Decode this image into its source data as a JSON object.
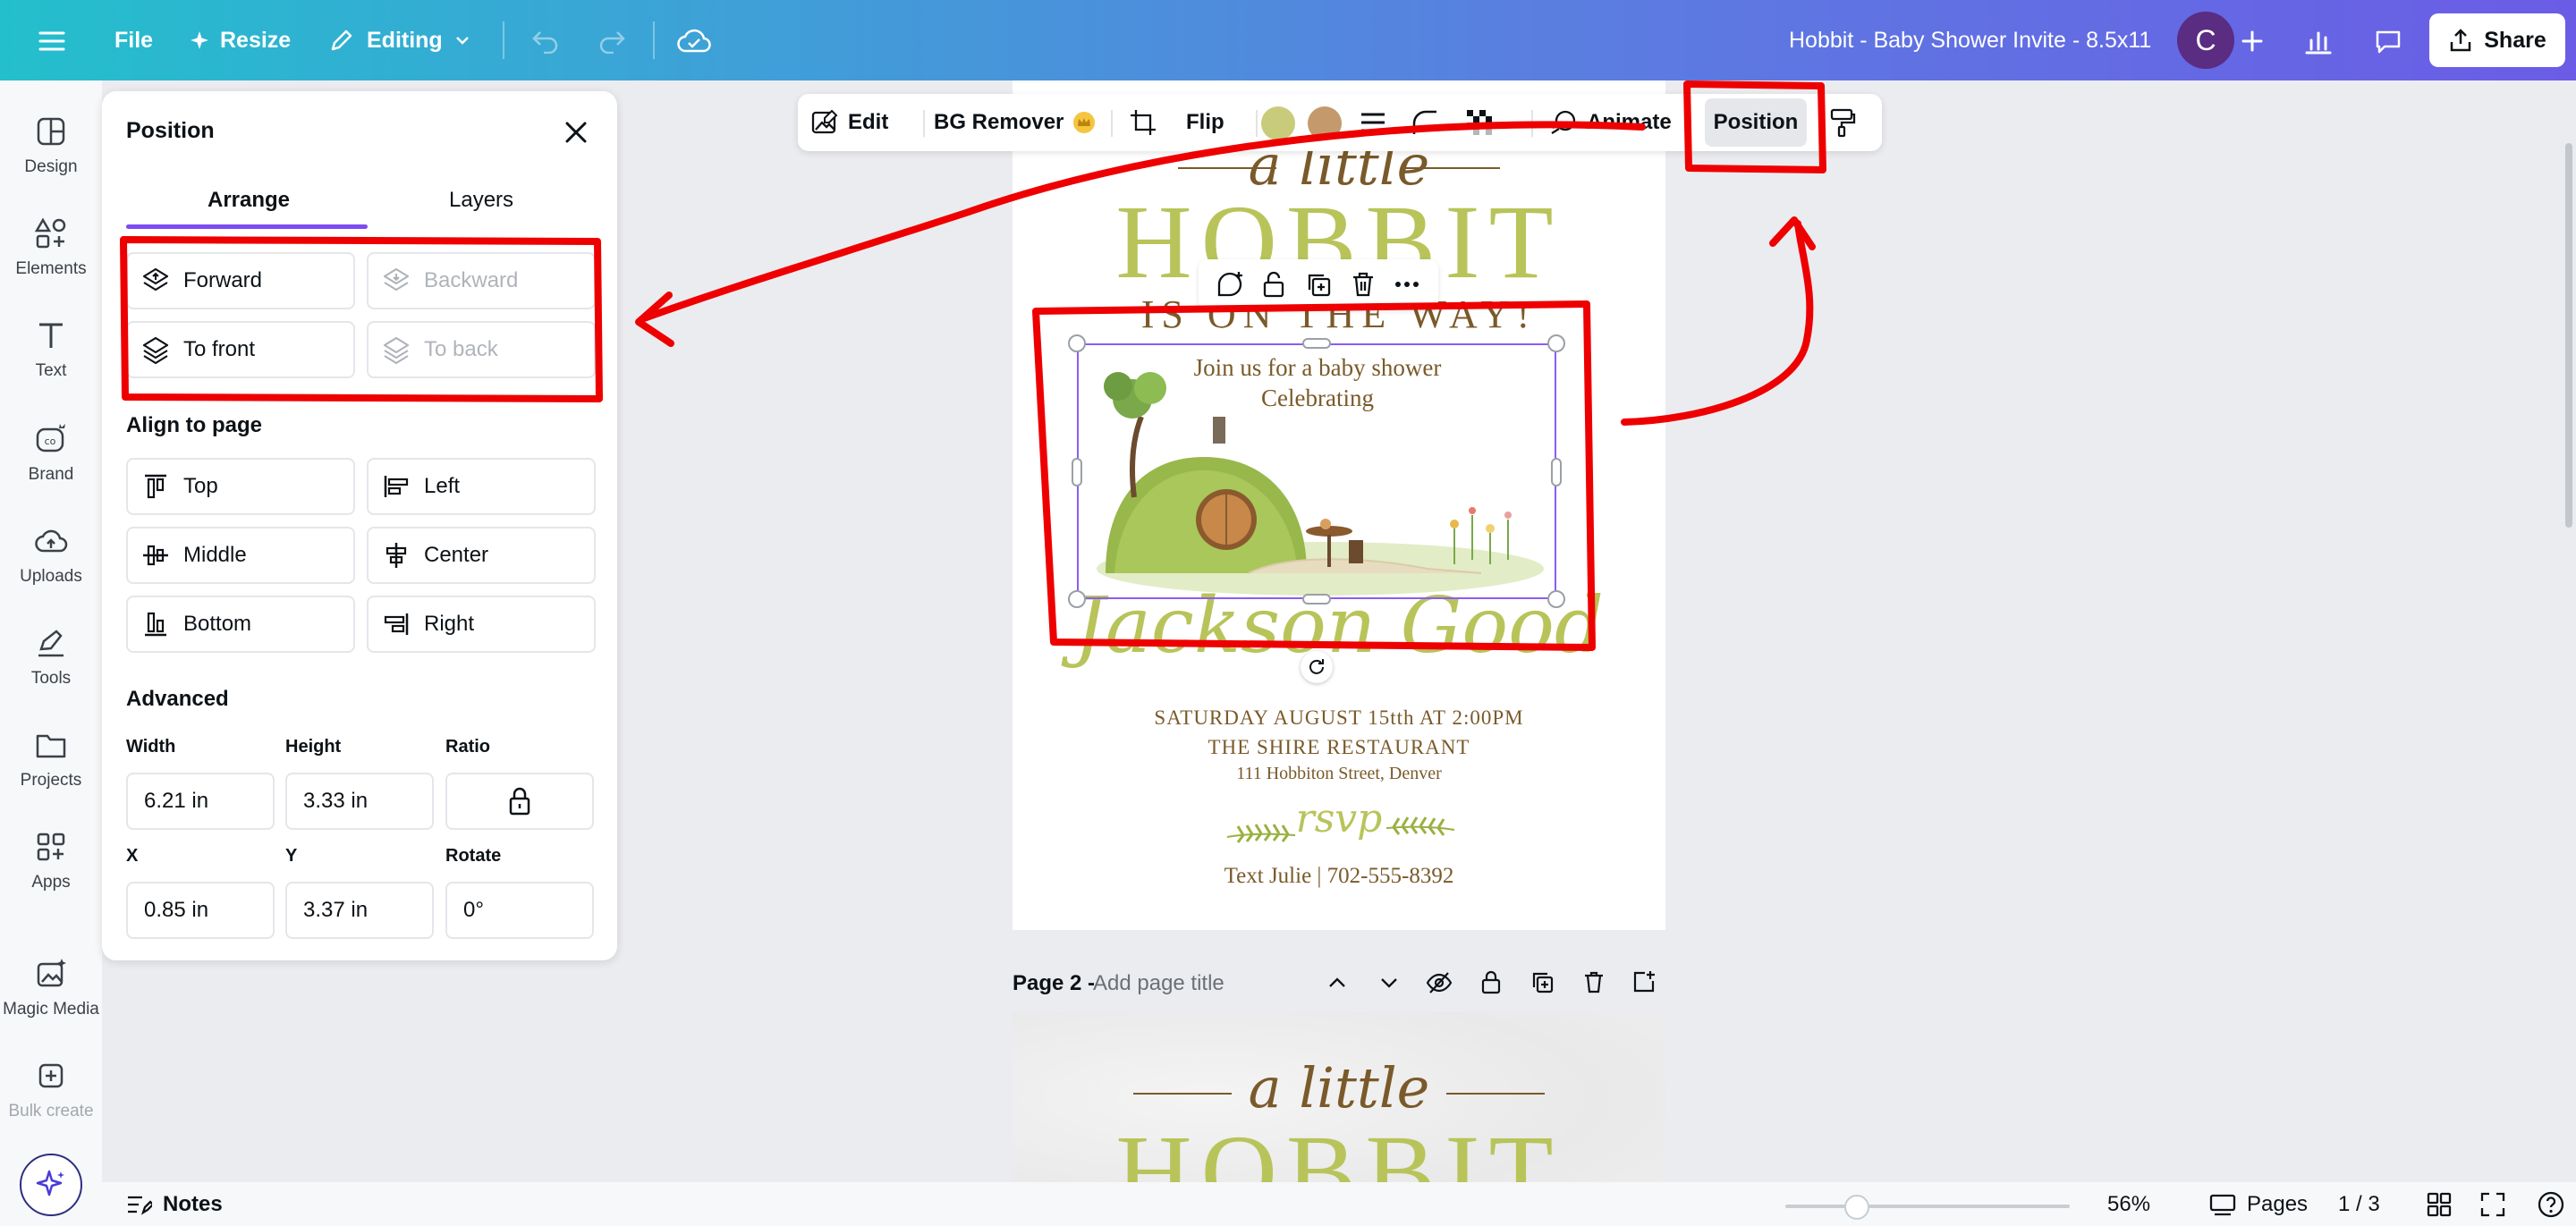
{
  "topbar": {
    "file": "File",
    "resize": "Resize",
    "editing": "Editing",
    "doc_title": "Hobbit - Baby Shower Invite - 8.5x11",
    "avatar_letter": "C",
    "share": "Share"
  },
  "leftrail": {
    "items": [
      "Design",
      "Elements",
      "Text",
      "Brand",
      "Uploads",
      "Tools",
      "Projects",
      "Apps",
      "Magic Media",
      "Bulk create"
    ]
  },
  "panel": {
    "title": "Position",
    "tabs": [
      "Arrange",
      "Layers"
    ],
    "arrange": {
      "forward": "Forward",
      "backward": "Backward",
      "to_front": "To front",
      "to_back": "To back"
    },
    "align_title": "Align to page",
    "align": {
      "top": "Top",
      "left": "Left",
      "middle": "Middle",
      "center": "Center",
      "bottom": "Bottom",
      "right": "Right"
    },
    "advanced_title": "Advanced",
    "labels": {
      "width": "Width",
      "height": "Height",
      "ratio": "Ratio",
      "x": "X",
      "y": "Y",
      "rotate": "Rotate"
    },
    "values": {
      "width": "6.21 in",
      "height": "3.33 in",
      "x": "0.85 in",
      "y": "3.37 in",
      "rotate": "0°"
    }
  },
  "toolbar": {
    "edit": "Edit",
    "bg_remover": "BG Remover",
    "flip": "Flip",
    "animate": "Animate",
    "position": "Position",
    "swatch_colors": [
      "#c8cc7a",
      "#c49a6c"
    ]
  },
  "invite": {
    "a_little": "a little",
    "hobbit": "HOBBIT",
    "on_the_way": "IS ON THE WAY!",
    "join_line1": "Join us for a baby shower",
    "join_line2": "Celebrating",
    "name": "Jackson Good",
    "date": "SATURDAY AUGUST 15tth AT 2:00PM",
    "venue": "THE SHIRE RESTAURANT",
    "address": "111 Hobbiton Street, Denver",
    "rsvp": "rsvp",
    "contact": "Text Julie | 702-555-8392"
  },
  "page2": {
    "label": "Page 2 -",
    "placeholder": "Add page title",
    "a_little": "a little",
    "hobbit": "HOBBIT"
  },
  "bottombar": {
    "notes": "Notes",
    "zoom": "56%",
    "zoom_fraction": 0.25,
    "pages": "Pages",
    "page_count": "1 / 3"
  },
  "colors": {
    "accent": "#7d4bf2",
    "annotation": "#ee0000",
    "invite_green": "#b8c45a",
    "invite_brown": "#7a5a2a"
  }
}
